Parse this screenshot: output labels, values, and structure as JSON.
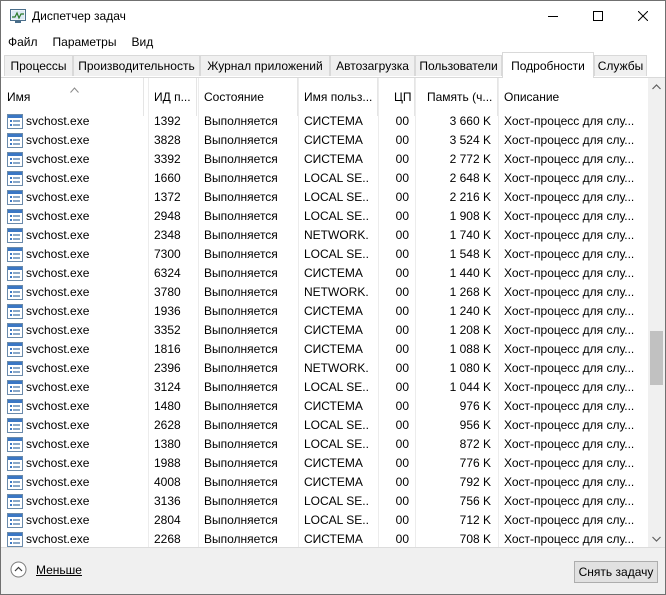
{
  "window": {
    "title": "Диспетчер задач"
  },
  "menu": [
    "Файл",
    "Параметры",
    "Вид"
  ],
  "tabs": [
    {
      "label": "Процессы",
      "active": false
    },
    {
      "label": "Производительность",
      "active": false
    },
    {
      "label": "Журнал приложений",
      "active": false
    },
    {
      "label": "Автозагрузка",
      "active": false
    },
    {
      "label": "Пользователи",
      "active": false
    },
    {
      "label": "Подробности",
      "active": true
    },
    {
      "label": "Службы",
      "active": false
    }
  ],
  "columns": {
    "name": "Имя",
    "pid": "ИД п...",
    "state": "Состояние",
    "user": "Имя польз...",
    "cpu": "ЦП",
    "memory": "Память (ч...",
    "description": "Описание"
  },
  "sort": {
    "column": "name",
    "direction": "ascending",
    "icon": "sort-up-chevron"
  },
  "rows": [
    {
      "name": "svchost.exe",
      "pid": "1392",
      "state": "Выполняется",
      "user": "СИСТЕМА",
      "cpu": "00",
      "memory": "3 660 K",
      "description": "Хост-процесс для слу..."
    },
    {
      "name": "svchost.exe",
      "pid": "3828",
      "state": "Выполняется",
      "user": "СИСТЕМА",
      "cpu": "00",
      "memory": "3 524 K",
      "description": "Хост-процесс для слу..."
    },
    {
      "name": "svchost.exe",
      "pid": "3392",
      "state": "Выполняется",
      "user": "СИСТЕМА",
      "cpu": "00",
      "memory": "2 772 K",
      "description": "Хост-процесс для слу..."
    },
    {
      "name": "svchost.exe",
      "pid": "1660",
      "state": "Выполняется",
      "user": "LOCAL SE...",
      "cpu": "00",
      "memory": "2 648 K",
      "description": "Хост-процесс для слу..."
    },
    {
      "name": "svchost.exe",
      "pid": "1372",
      "state": "Выполняется",
      "user": "LOCAL SE...",
      "cpu": "00",
      "memory": "2 216 K",
      "description": "Хост-процесс для слу..."
    },
    {
      "name": "svchost.exe",
      "pid": "2948",
      "state": "Выполняется",
      "user": "LOCAL SE...",
      "cpu": "00",
      "memory": "1 908 K",
      "description": "Хост-процесс для слу..."
    },
    {
      "name": "svchost.exe",
      "pid": "2348",
      "state": "Выполняется",
      "user": "NETWORK...",
      "cpu": "00",
      "memory": "1 740 K",
      "description": "Хост-процесс для слу..."
    },
    {
      "name": "svchost.exe",
      "pid": "7300",
      "state": "Выполняется",
      "user": "LOCAL SE...",
      "cpu": "00",
      "memory": "1 548 K",
      "description": "Хост-процесс для слу..."
    },
    {
      "name": "svchost.exe",
      "pid": "6324",
      "state": "Выполняется",
      "user": "СИСТЕМА",
      "cpu": "00",
      "memory": "1 440 K",
      "description": "Хост-процесс для слу..."
    },
    {
      "name": "svchost.exe",
      "pid": "3780",
      "state": "Выполняется",
      "user": "NETWORK...",
      "cpu": "00",
      "memory": "1 268 K",
      "description": "Хост-процесс для слу..."
    },
    {
      "name": "svchost.exe",
      "pid": "1936",
      "state": "Выполняется",
      "user": "СИСТЕМА",
      "cpu": "00",
      "memory": "1 240 K",
      "description": "Хост-процесс для слу..."
    },
    {
      "name": "svchost.exe",
      "pid": "3352",
      "state": "Выполняется",
      "user": "СИСТЕМА",
      "cpu": "00",
      "memory": "1 208 K",
      "description": "Хост-процесс для слу..."
    },
    {
      "name": "svchost.exe",
      "pid": "1816",
      "state": "Выполняется",
      "user": "СИСТЕМА",
      "cpu": "00",
      "memory": "1 088 K",
      "description": "Хост-процесс для слу..."
    },
    {
      "name": "svchost.exe",
      "pid": "2396",
      "state": "Выполняется",
      "user": "NETWORK...",
      "cpu": "00",
      "memory": "1 080 K",
      "description": "Хост-процесс для слу..."
    },
    {
      "name": "svchost.exe",
      "pid": "3124",
      "state": "Выполняется",
      "user": "LOCAL SE...",
      "cpu": "00",
      "memory": "1 044 K",
      "description": "Хост-процесс для слу..."
    },
    {
      "name": "svchost.exe",
      "pid": "1480",
      "state": "Выполняется",
      "user": "СИСТЕМА",
      "cpu": "00",
      "memory": "976 K",
      "description": "Хост-процесс для слу..."
    },
    {
      "name": "svchost.exe",
      "pid": "2628",
      "state": "Выполняется",
      "user": "LOCAL SE...",
      "cpu": "00",
      "memory": "956 K",
      "description": "Хост-процесс для слу..."
    },
    {
      "name": "svchost.exe",
      "pid": "1380",
      "state": "Выполняется",
      "user": "LOCAL SE...",
      "cpu": "00",
      "memory": "872 K",
      "description": "Хост-процесс для слу..."
    },
    {
      "name": "svchost.exe",
      "pid": "1988",
      "state": "Выполняется",
      "user": "СИСТЕМА",
      "cpu": "00",
      "memory": "776 K",
      "description": "Хост-процесс для слу..."
    },
    {
      "name": "svchost.exe",
      "pid": "4008",
      "state": "Выполняется",
      "user": "СИСТЕМА",
      "cpu": "00",
      "memory": "792 K",
      "description": "Хост-процесс для слу..."
    },
    {
      "name": "svchost.exe",
      "pid": "3136",
      "state": "Выполняется",
      "user": "LOCAL SE...",
      "cpu": "00",
      "memory": "756 K",
      "description": "Хост-процесс для слу..."
    },
    {
      "name": "svchost.exe",
      "pid": "2804",
      "state": "Выполняется",
      "user": "LOCAL SE...",
      "cpu": "00",
      "memory": "712 K",
      "description": "Хост-процесс для слу..."
    },
    {
      "name": "svchost.exe",
      "pid": "2268",
      "state": "Выполняется",
      "user": "СИСТЕМА",
      "cpu": "00",
      "memory": "708 K",
      "description": "Хост-процесс для слу..."
    }
  ],
  "scroll": {
    "position_fraction": 0.62
  },
  "footer": {
    "less_label": "Меньше",
    "end_task_label": "Снять задачу"
  },
  "icons": {
    "app": "task-manager-icon",
    "process": "process-window-icon",
    "less": "chevron-up-circle-icon"
  }
}
